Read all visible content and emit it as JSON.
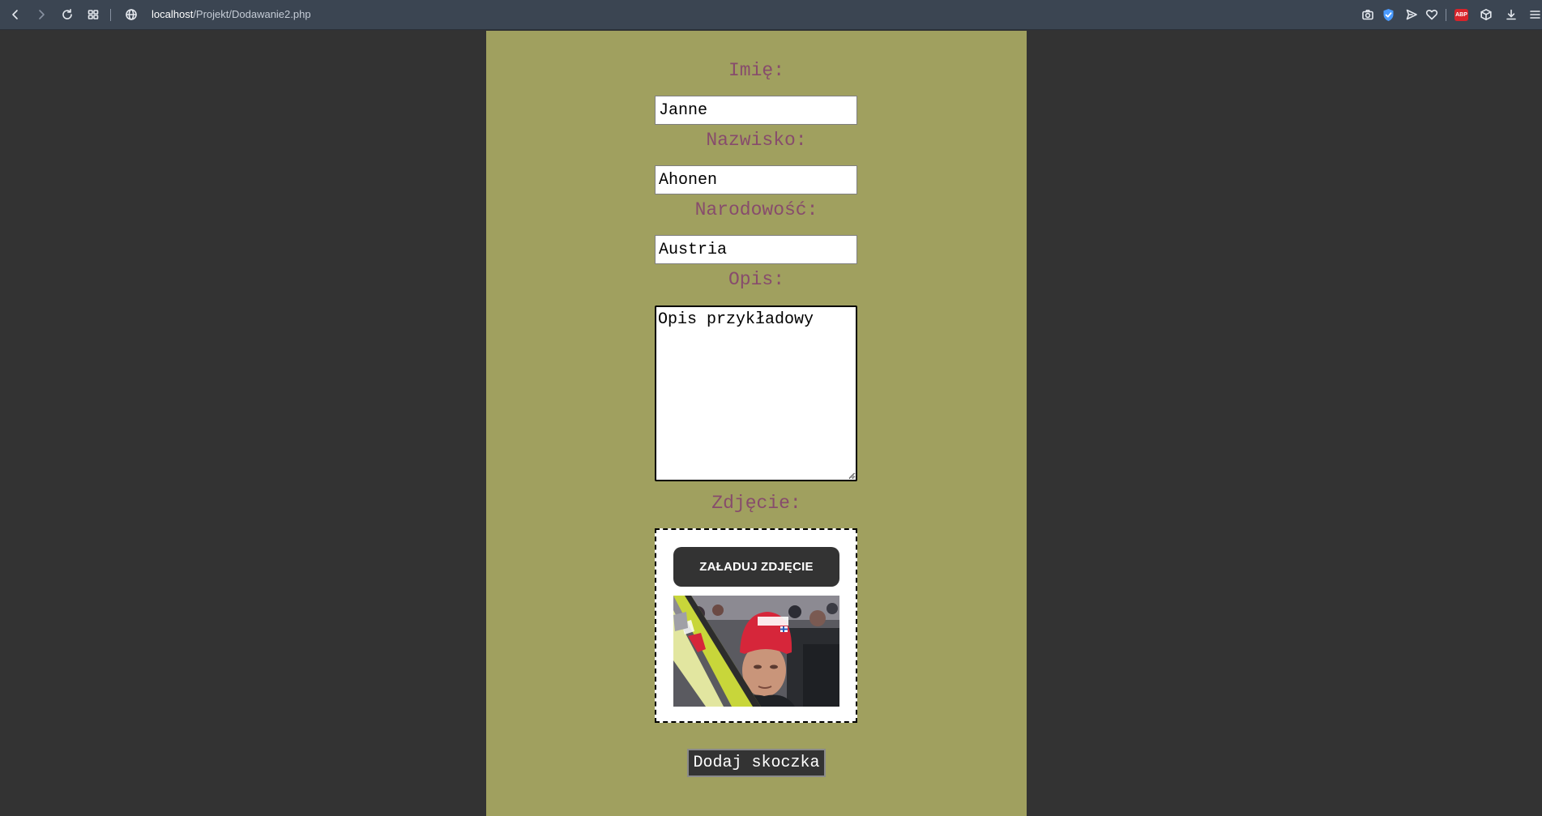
{
  "browser": {
    "url_host": "localhost",
    "url_path": "/Projekt/Dodawanie2.php",
    "abp_label": "ABP",
    "icons": [
      "back-icon",
      "forward-icon",
      "reload-icon",
      "tabs-grid-icon",
      "globe-icon",
      "camera-icon",
      "shield-icon",
      "send-icon",
      "heart-icon",
      "adblock-icon",
      "box-icon",
      "download-icon",
      "menu-icon"
    ]
  },
  "form": {
    "first_name_label": "Imię:",
    "first_name_value": "Janne",
    "last_name_label": "Nazwisko:",
    "last_name_value": "Ahonen",
    "nationality_label": "Narodowość:",
    "nationality_value": "Austria",
    "description_label": "Opis:",
    "description_value": "Opis przykładowy",
    "photo_label": "Zdjęcie:",
    "upload_button": "ZAŁADUJ ZDJĘCIE",
    "submit_button": "Dodaj skoczka"
  },
  "colors": {
    "page_background": "#333333",
    "card_background": "#a0a05f",
    "label_color": "#874c6c",
    "button_dark": "#333333"
  }
}
